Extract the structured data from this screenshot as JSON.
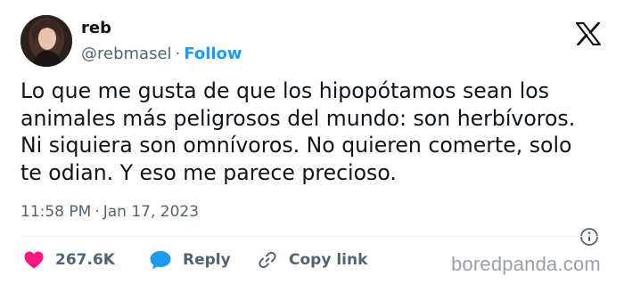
{
  "user": {
    "name": "reb",
    "handle": "@rebmasel",
    "separator": "·",
    "follow_label": "Follow"
  },
  "tweet": {
    "text": "Lo que me gusta de que los hipopótamos sean los\nanimales más peligrosos del mundo: son herbívoros.\nNi siquiera son omnívoros. No quieren comerte, solo\nte odian. Y eso me parece precioso.",
    "time": "11:58 PM",
    "date_separator": "·",
    "date": "Jan 17, 2023"
  },
  "actions": {
    "likes_count": "267.6K",
    "reply_label": "Reply",
    "copy_link_label": "Copy link"
  },
  "watermark": "boredpanda.com",
  "colors": {
    "follow": "#1d9bf0",
    "like_heart": "#f91880",
    "reply_bubble": "#1d9bf0",
    "secondary_text": "#536471"
  },
  "icons": {
    "brand": "x-logo-icon",
    "info": "info-icon",
    "like": "heart-icon",
    "reply": "speech-bubble-icon",
    "copy": "link-icon"
  }
}
